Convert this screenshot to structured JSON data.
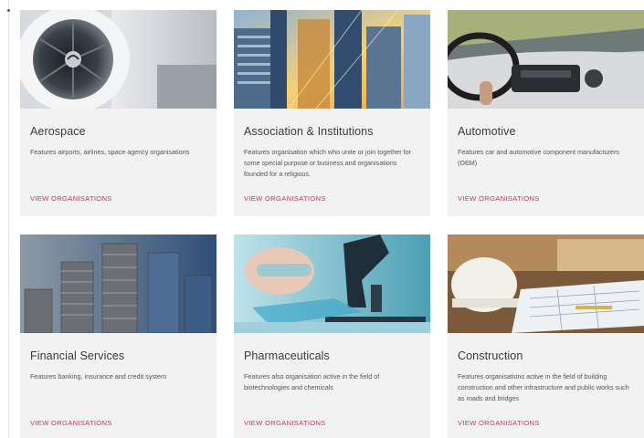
{
  "cards": [
    {
      "title": "Aerospace",
      "description": "Features airports, airlines, space agency organisations",
      "link": "VIEW ORGANISATIONS"
    },
    {
      "title": "Association & Institutions",
      "description": "Features organisation which who unite or join together for some special purpose or business and organisations founded for a religious.",
      "link": "VIEW ORGANISATIONS"
    },
    {
      "title": "Automotive",
      "description": "Features car and automotive component manufacturers (OEM)",
      "link": "VIEW ORGANISATIONS"
    },
    {
      "title": "Financial Services",
      "description": "Features banking, insurance and credit system",
      "link": "VIEW ORGANISATIONS"
    },
    {
      "title": "Pharmaceuticals",
      "description": "Features also organisation active in the field of biotechnologies and chemicals",
      "link": "VIEW ORGANISATIONS"
    },
    {
      "title": "Construction",
      "description": "Features organisations active in the field of building construction and other infrastructure and public works such as roads and bridges",
      "link": "VIEW ORGANISATIONS"
    }
  ],
  "colors": {
    "card_bg": "#f2f2f3",
    "link": "#c2336b",
    "title": "#3a3a3a"
  }
}
